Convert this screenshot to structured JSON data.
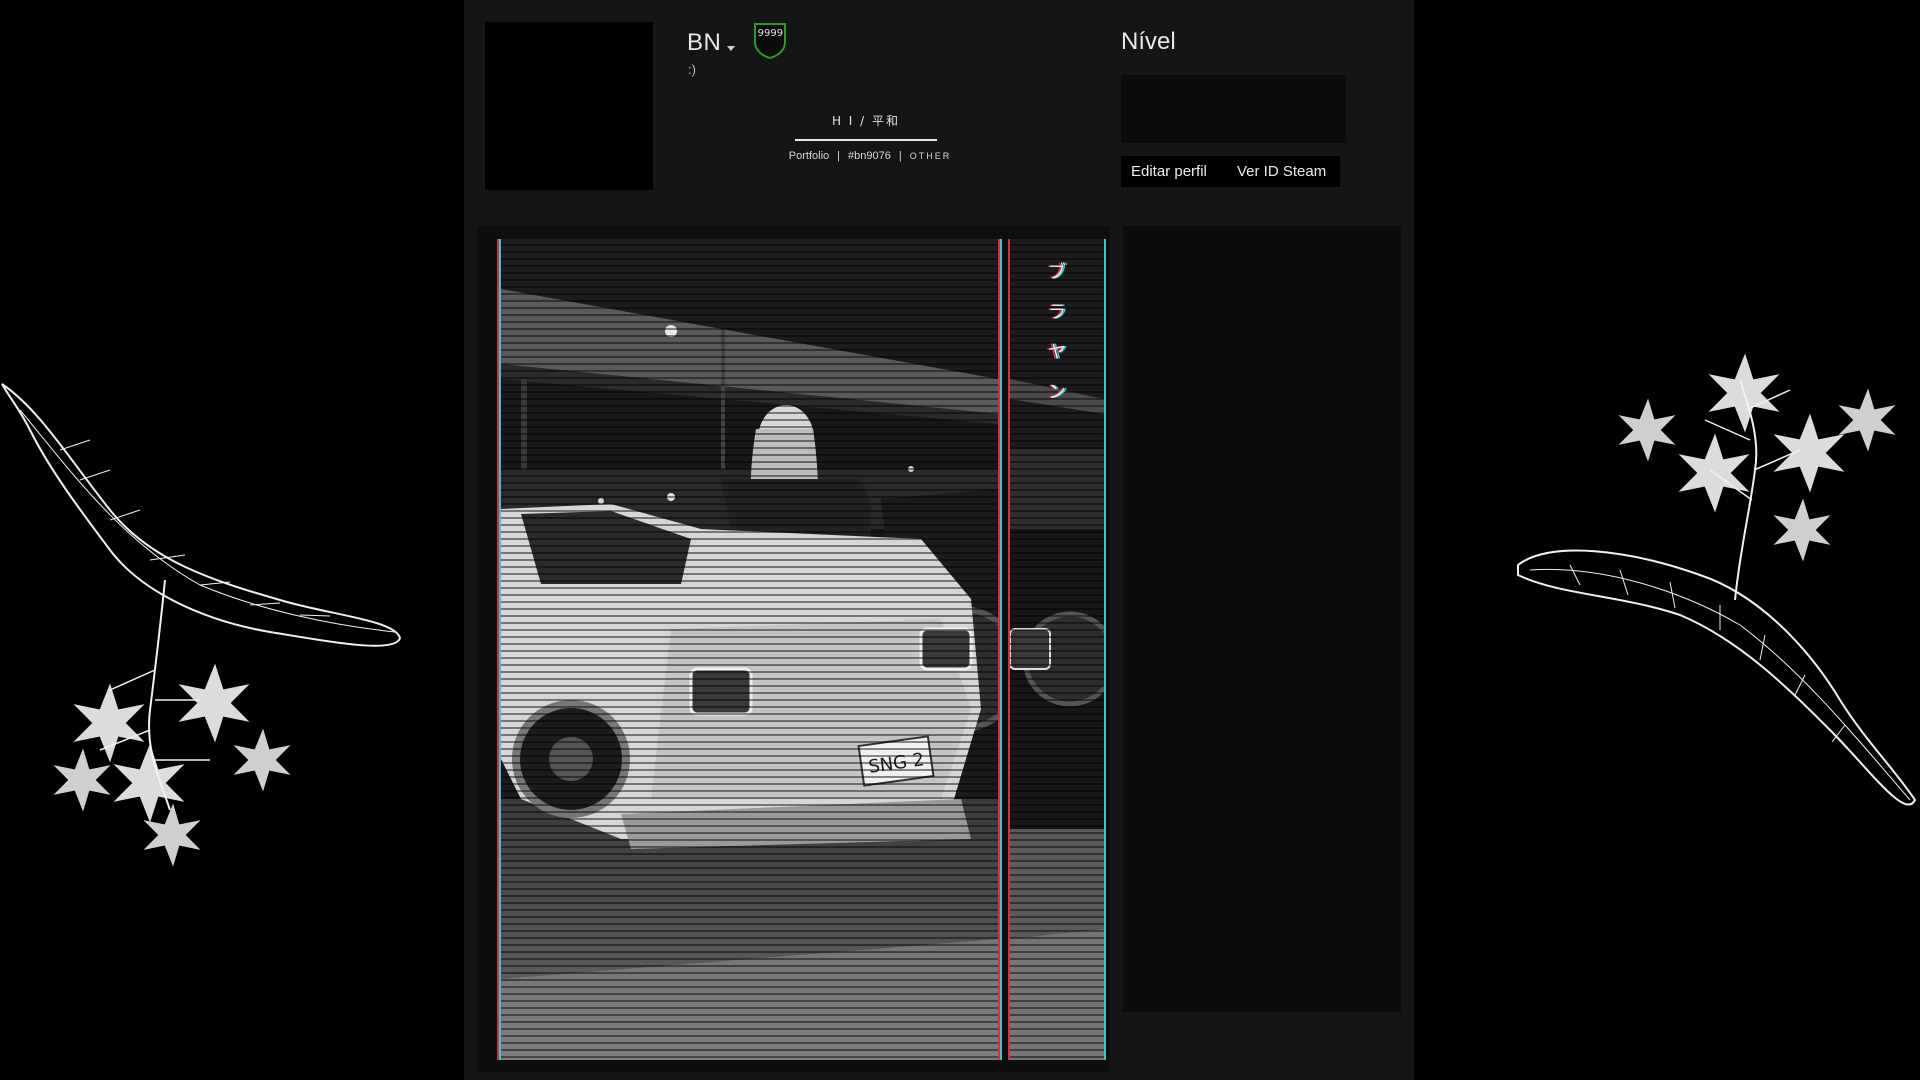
{
  "profile": {
    "persona_name": "BN",
    "badge_level": "9999",
    "persona_sub": ":)",
    "summary": {
      "title": "H I  /  平和",
      "links": [
        "Portfolio",
        "#bn9076",
        "OTHER"
      ]
    },
    "level_label": "Nível",
    "buttons": {
      "edit_profile": "Editar perfil",
      "view_steam_id": "Ver ID Steam"
    }
  },
  "showcase": {
    "vertical_text": [
      "ブ",
      "ラ",
      "ヤ",
      "ン"
    ],
    "plate_text": "SNG 2"
  },
  "colors": {
    "background": "#000000",
    "profile_panel": "#151515",
    "badge_green": "#2a7a2a",
    "glitch_cyan": "#36c9cc",
    "glitch_red": "#d93040"
  },
  "icons": {
    "dropdown": "chevron-down-icon",
    "level_badge": "shield-badge-icon",
    "decor_left": "flower-branch-illustration",
    "decor_right": "flower-branch-illustration"
  }
}
